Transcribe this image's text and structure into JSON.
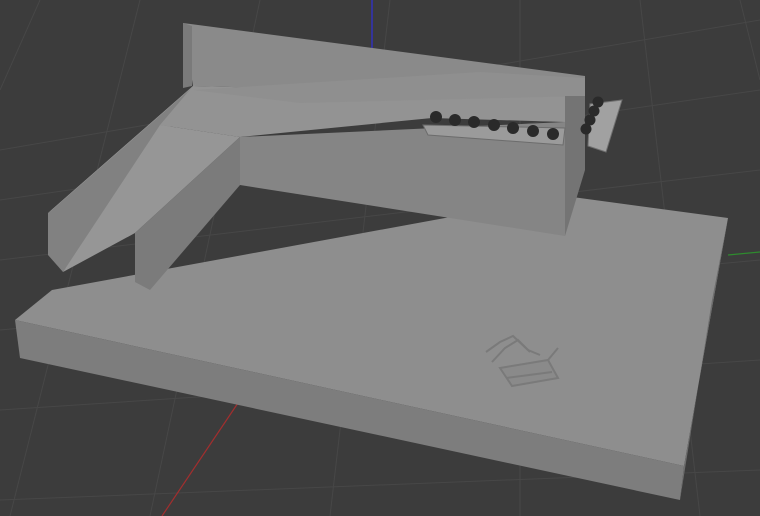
{
  "viewport": {
    "background": "#3c3c3c",
    "grid_color": "#444444",
    "axis_colors": {
      "x": "#a22e2e",
      "y": "#2e8b2e",
      "z": "#2f2fd8"
    }
  },
  "scene": {
    "model_color": "#8c8c8c",
    "ball_color": "#2a2a2a",
    "ball_rows": {
      "main_row_count": 7,
      "side_row_count": 4
    }
  }
}
